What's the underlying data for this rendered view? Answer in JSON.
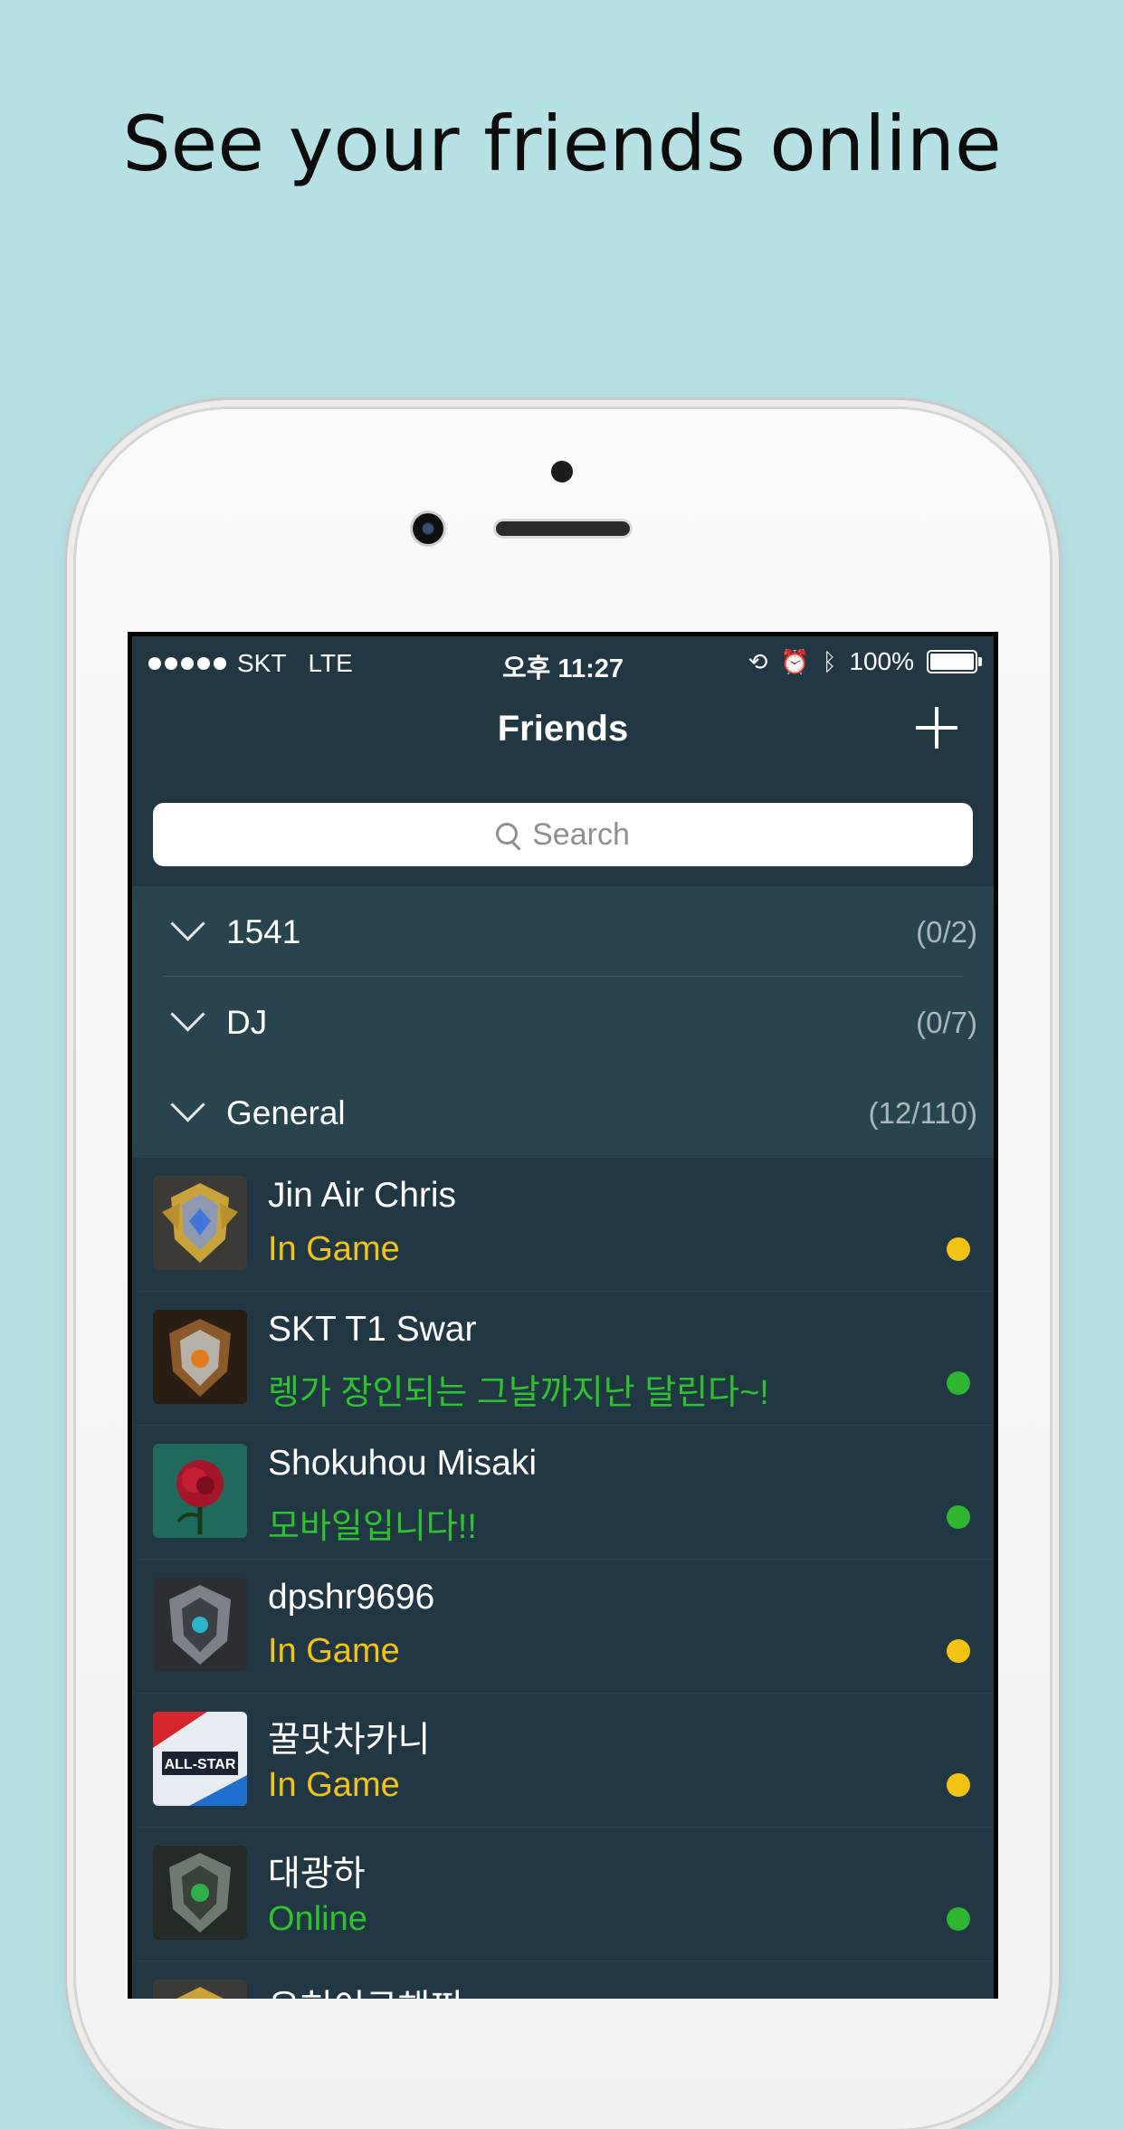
{
  "headline": "See your friends online",
  "status_bar": {
    "carrier": "SKT",
    "network": "LTE",
    "time": "오후 11:27",
    "battery": "100%"
  },
  "nav": {
    "title": "Friends",
    "add_icon": "plus-icon"
  },
  "search": {
    "placeholder": "Search"
  },
  "groups": [
    {
      "name": "1541",
      "count": "(0/2)"
    },
    {
      "name": "DJ",
      "count": "(0/7)"
    },
    {
      "name": "General",
      "count": "(12/110)"
    }
  ],
  "friends": [
    {
      "name": "Jin Air Chris",
      "status": "In Game",
      "status_color": "#f2c315",
      "dot_color": "#f2c315",
      "avatar": "gold-crest-avatar"
    },
    {
      "name": "SKT T1 Swar",
      "status": "렝가 장인되는 그날까지난 달린다~!",
      "status_color": "#2fc22f",
      "dot_color": "#2fb52f",
      "avatar": "bronze-shield-avatar"
    },
    {
      "name": "Shokuhou Misaki",
      "status": "모바일입니다!!",
      "status_color": "#2fc22f",
      "dot_color": "#2fb52f",
      "avatar": "red-rose-avatar"
    },
    {
      "name": "dpshr9696",
      "status": "In Game",
      "status_color": "#f2c315",
      "dot_color": "#f2c315",
      "avatar": "silver-crest-avatar"
    },
    {
      "name": "꿀맛차카니",
      "status": "In Game",
      "status_color": "#f2c315",
      "dot_color": "#f2c315",
      "avatar": "all-star-2015-avatar",
      "avatar_text": "ALL-STAR"
    },
    {
      "name": "대광하",
      "status": "Online",
      "status_color": "#2fc22f",
      "dot_color": "#2fb52f",
      "avatar": "green-gem-crest-avatar"
    },
    {
      "name": "유혀이쿠해쪄",
      "status": "",
      "status_color": "#2fc22f",
      "dot_color": "#2fb52f",
      "avatar": "gold-crest-avatar"
    }
  ]
}
